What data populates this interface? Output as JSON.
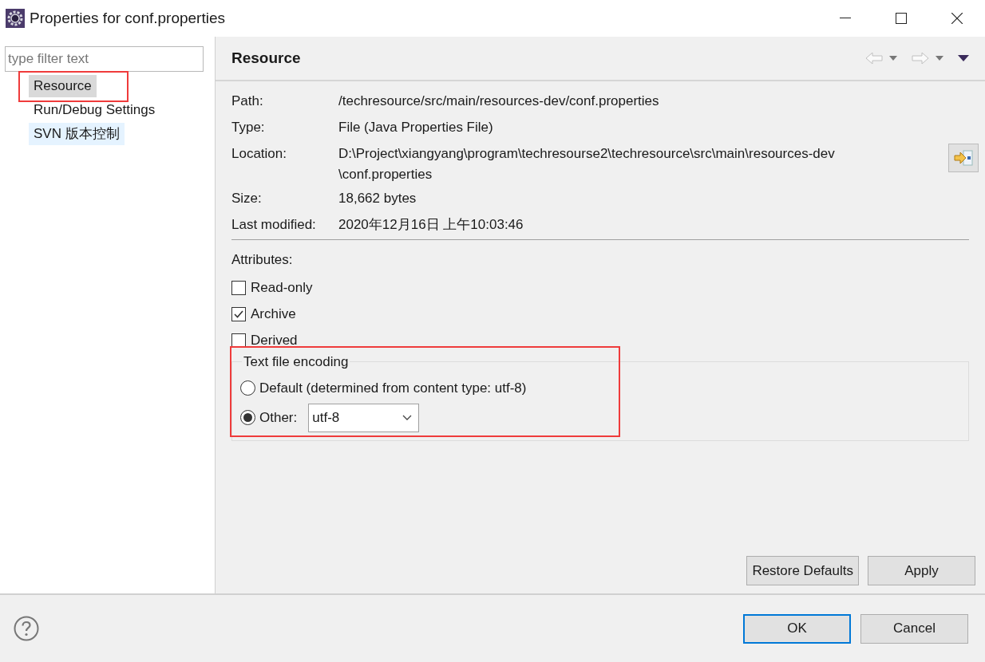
{
  "window": {
    "title": "Properties for conf.properties"
  },
  "filter": {
    "placeholder": "type filter text"
  },
  "sidebar": {
    "items": [
      {
        "label": "Resource",
        "selected": true,
        "highlighted": false
      },
      {
        "label": "Run/Debug Settings",
        "selected": false,
        "highlighted": false
      },
      {
        "label": "SVN 版本控制",
        "selected": false,
        "highlighted": true
      }
    ]
  },
  "page": {
    "title": "Resource",
    "info": [
      {
        "label": "Path:",
        "value": [
          "/techresource/src/main/resources-dev/conf.properties"
        ]
      },
      {
        "label": "Type:",
        "value": [
          "File  (Java Properties File)"
        ]
      },
      {
        "label": "Location:",
        "value": [
          "D:\\Project\\xiangyang\\program\\techresourse2\\techresource\\src\\main\\resources-dev",
          "\\conf.properties"
        ]
      },
      {
        "label": "Size:",
        "value": [
          "18,662  bytes"
        ]
      },
      {
        "label": "Last modified:",
        "value": [
          "2020年12月16日 上午10:03:46"
        ]
      }
    ],
    "attributes_label": "Attributes:",
    "attributes": [
      {
        "label": "Read-only",
        "checked": false
      },
      {
        "label": "Archive",
        "checked": true
      },
      {
        "label": "Derived",
        "checked": false
      }
    ],
    "encoding": {
      "title": "Text file encoding",
      "options": [
        {
          "label": "Default (determined from content type: utf-8)",
          "selected": false
        },
        {
          "label": "Other:",
          "selected": true
        }
      ],
      "value": "utf-8"
    },
    "buttons": [
      "Restore Defaults",
      "Apply"
    ]
  },
  "footer": {
    "buttons": [
      {
        "label": "OK",
        "default": true
      },
      {
        "label": "Cancel",
        "default": false
      }
    ]
  }
}
